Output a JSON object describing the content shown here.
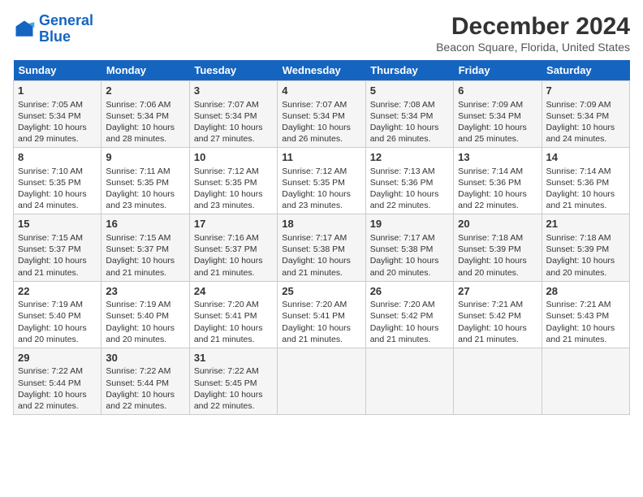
{
  "logo": {
    "line1": "General",
    "line2": "Blue"
  },
  "title": "December 2024",
  "subtitle": "Beacon Square, Florida, United States",
  "days_of_week": [
    "Sunday",
    "Monday",
    "Tuesday",
    "Wednesday",
    "Thursday",
    "Friday",
    "Saturday"
  ],
  "weeks": [
    [
      {
        "day": 1,
        "info": [
          "Sunrise: 7:05 AM",
          "Sunset: 5:34 PM",
          "Daylight: 10 hours",
          "and 29 minutes."
        ]
      },
      {
        "day": 2,
        "info": [
          "Sunrise: 7:06 AM",
          "Sunset: 5:34 PM",
          "Daylight: 10 hours",
          "and 28 minutes."
        ]
      },
      {
        "day": 3,
        "info": [
          "Sunrise: 7:07 AM",
          "Sunset: 5:34 PM",
          "Daylight: 10 hours",
          "and 27 minutes."
        ]
      },
      {
        "day": 4,
        "info": [
          "Sunrise: 7:07 AM",
          "Sunset: 5:34 PM",
          "Daylight: 10 hours",
          "and 26 minutes."
        ]
      },
      {
        "day": 5,
        "info": [
          "Sunrise: 7:08 AM",
          "Sunset: 5:34 PM",
          "Daylight: 10 hours",
          "and 26 minutes."
        ]
      },
      {
        "day": 6,
        "info": [
          "Sunrise: 7:09 AM",
          "Sunset: 5:34 PM",
          "Daylight: 10 hours",
          "and 25 minutes."
        ]
      },
      {
        "day": 7,
        "info": [
          "Sunrise: 7:09 AM",
          "Sunset: 5:34 PM",
          "Daylight: 10 hours",
          "and 24 minutes."
        ]
      }
    ],
    [
      {
        "day": 8,
        "info": [
          "Sunrise: 7:10 AM",
          "Sunset: 5:35 PM",
          "Daylight: 10 hours",
          "and 24 minutes."
        ]
      },
      {
        "day": 9,
        "info": [
          "Sunrise: 7:11 AM",
          "Sunset: 5:35 PM",
          "Daylight: 10 hours",
          "and 23 minutes."
        ]
      },
      {
        "day": 10,
        "info": [
          "Sunrise: 7:12 AM",
          "Sunset: 5:35 PM",
          "Daylight: 10 hours",
          "and 23 minutes."
        ]
      },
      {
        "day": 11,
        "info": [
          "Sunrise: 7:12 AM",
          "Sunset: 5:35 PM",
          "Daylight: 10 hours",
          "and 23 minutes."
        ]
      },
      {
        "day": 12,
        "info": [
          "Sunrise: 7:13 AM",
          "Sunset: 5:36 PM",
          "Daylight: 10 hours",
          "and 22 minutes."
        ]
      },
      {
        "day": 13,
        "info": [
          "Sunrise: 7:14 AM",
          "Sunset: 5:36 PM",
          "Daylight: 10 hours",
          "and 22 minutes."
        ]
      },
      {
        "day": 14,
        "info": [
          "Sunrise: 7:14 AM",
          "Sunset: 5:36 PM",
          "Daylight: 10 hours",
          "and 21 minutes."
        ]
      }
    ],
    [
      {
        "day": 15,
        "info": [
          "Sunrise: 7:15 AM",
          "Sunset: 5:37 PM",
          "Daylight: 10 hours",
          "and 21 minutes."
        ]
      },
      {
        "day": 16,
        "info": [
          "Sunrise: 7:15 AM",
          "Sunset: 5:37 PM",
          "Daylight: 10 hours",
          "and 21 minutes."
        ]
      },
      {
        "day": 17,
        "info": [
          "Sunrise: 7:16 AM",
          "Sunset: 5:37 PM",
          "Daylight: 10 hours",
          "and 21 minutes."
        ]
      },
      {
        "day": 18,
        "info": [
          "Sunrise: 7:17 AM",
          "Sunset: 5:38 PM",
          "Daylight: 10 hours",
          "and 21 minutes."
        ]
      },
      {
        "day": 19,
        "info": [
          "Sunrise: 7:17 AM",
          "Sunset: 5:38 PM",
          "Daylight: 10 hours",
          "and 20 minutes."
        ]
      },
      {
        "day": 20,
        "info": [
          "Sunrise: 7:18 AM",
          "Sunset: 5:39 PM",
          "Daylight: 10 hours",
          "and 20 minutes."
        ]
      },
      {
        "day": 21,
        "info": [
          "Sunrise: 7:18 AM",
          "Sunset: 5:39 PM",
          "Daylight: 10 hours",
          "and 20 minutes."
        ]
      }
    ],
    [
      {
        "day": 22,
        "info": [
          "Sunrise: 7:19 AM",
          "Sunset: 5:40 PM",
          "Daylight: 10 hours",
          "and 20 minutes."
        ]
      },
      {
        "day": 23,
        "info": [
          "Sunrise: 7:19 AM",
          "Sunset: 5:40 PM",
          "Daylight: 10 hours",
          "and 20 minutes."
        ]
      },
      {
        "day": 24,
        "info": [
          "Sunrise: 7:20 AM",
          "Sunset: 5:41 PM",
          "Daylight: 10 hours",
          "and 21 minutes."
        ]
      },
      {
        "day": 25,
        "info": [
          "Sunrise: 7:20 AM",
          "Sunset: 5:41 PM",
          "Daylight: 10 hours",
          "and 21 minutes."
        ]
      },
      {
        "day": 26,
        "info": [
          "Sunrise: 7:20 AM",
          "Sunset: 5:42 PM",
          "Daylight: 10 hours",
          "and 21 minutes."
        ]
      },
      {
        "day": 27,
        "info": [
          "Sunrise: 7:21 AM",
          "Sunset: 5:42 PM",
          "Daylight: 10 hours",
          "and 21 minutes."
        ]
      },
      {
        "day": 28,
        "info": [
          "Sunrise: 7:21 AM",
          "Sunset: 5:43 PM",
          "Daylight: 10 hours",
          "and 21 minutes."
        ]
      }
    ],
    [
      {
        "day": 29,
        "info": [
          "Sunrise: 7:22 AM",
          "Sunset: 5:44 PM",
          "Daylight: 10 hours",
          "and 22 minutes."
        ]
      },
      {
        "day": 30,
        "info": [
          "Sunrise: 7:22 AM",
          "Sunset: 5:44 PM",
          "Daylight: 10 hours",
          "and 22 minutes."
        ]
      },
      {
        "day": 31,
        "info": [
          "Sunrise: 7:22 AM",
          "Sunset: 5:45 PM",
          "Daylight: 10 hours",
          "and 22 minutes."
        ]
      },
      null,
      null,
      null,
      null
    ]
  ]
}
